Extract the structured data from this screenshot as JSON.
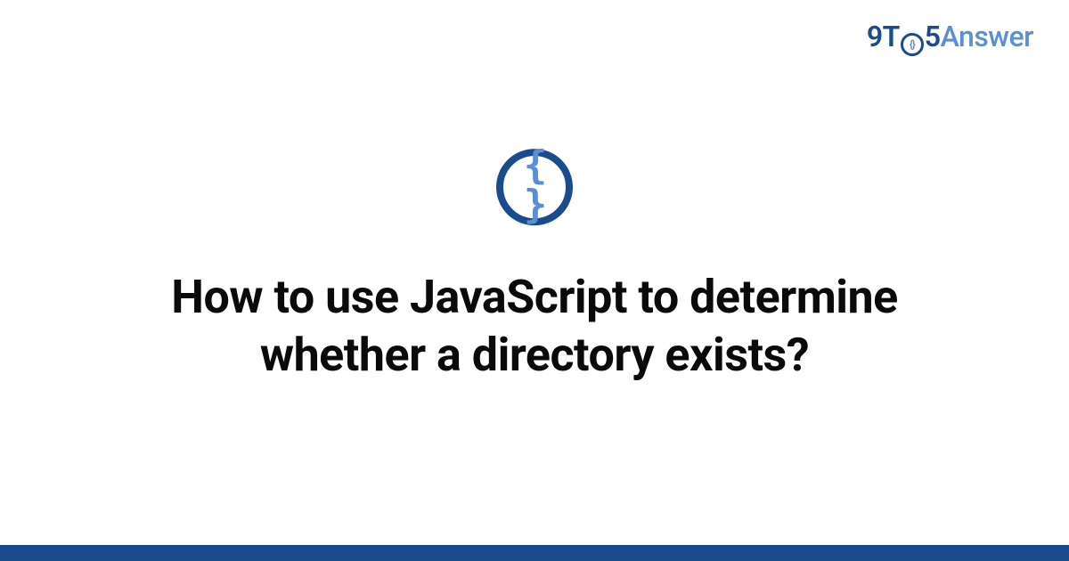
{
  "logo": {
    "prefix": "9T",
    "middle": "5",
    "suffix": "Answer"
  },
  "badge": {
    "glyph": "{ }"
  },
  "title": "How to use JavaScript to determine whether a directory exists?",
  "colors": {
    "primary": "#1a4b8c",
    "accent": "#5a8fd6"
  }
}
